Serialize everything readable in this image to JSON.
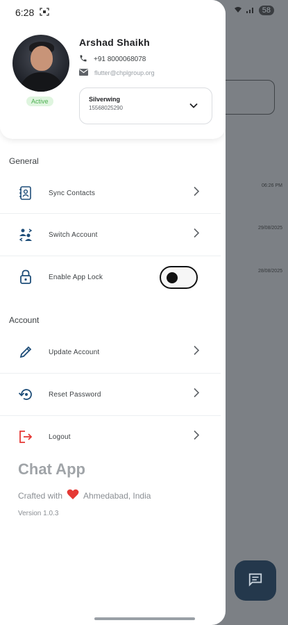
{
  "status_bar": {
    "time": "6:28",
    "battery": "58"
  },
  "background": {
    "timestamps": [
      "06:26 PM",
      "29/08/2025",
      "28/08/2025"
    ]
  },
  "profile": {
    "name": "Arshad Shaikh",
    "phone": "+91 8000068078",
    "email": "flutter@chplgroup.org",
    "status": "Active",
    "account_select": {
      "title": "Silverwing",
      "subtitle": "15568025290"
    }
  },
  "sections": {
    "general": "General",
    "account": "Account"
  },
  "menu": {
    "sync_contacts": "Sync Contacts",
    "switch_account": "Switch Account",
    "enable_app_lock": "Enable App Lock",
    "update_account": "Update Account",
    "reset_password": "Reset Password",
    "logout": "Logout"
  },
  "toggles": {
    "app_lock_enabled": false
  },
  "footer": {
    "app_name": "Chat App",
    "crafted_with": "Crafted with",
    "location": "Ahmedabad, India",
    "version": "Version 1.0.3"
  },
  "colors": {
    "accent": "#1f4e79",
    "logout": "#e53935",
    "active_badge_bg": "#dff5df",
    "active_badge_text": "#4caf50",
    "fab": "#24384c",
    "heart": "#e53935"
  },
  "icons": {
    "sync_contacts": "contacts-sync-icon",
    "switch_account": "switch-account-icon",
    "enable_app_lock": "lock-icon",
    "update_account": "pencil-icon",
    "reset_password": "reset-icon",
    "logout": "logout-icon",
    "fab": "message-icon"
  }
}
